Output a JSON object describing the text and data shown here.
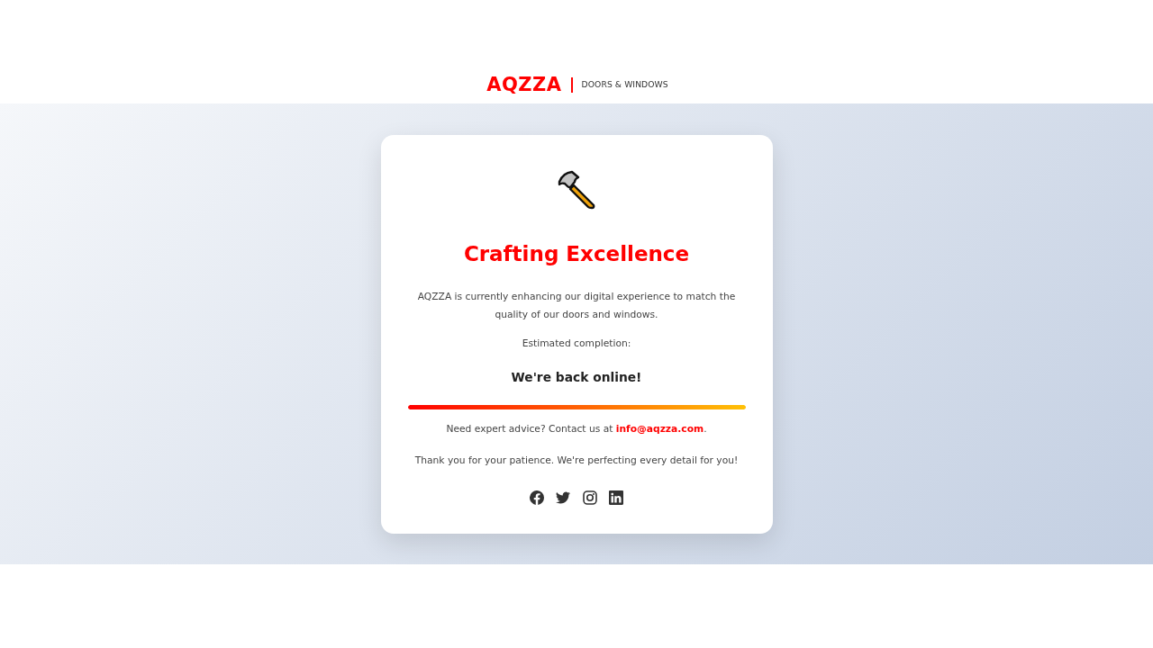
{
  "header": {
    "logo": "AQZZA",
    "tagline": "DOORS & WINDOWS"
  },
  "card": {
    "title": "Crafting Excellence",
    "message": "AQZZA is currently enhancing our digital experience to match the quality of our doors and windows.",
    "eta_label": "Estimated completion:",
    "eta_value": "We're back online!",
    "progress": {
      "level": 1
    },
    "contact": {
      "before": "Need expert advice? Contact us at ",
      "email": "info@aqzza.com",
      "after": "."
    },
    "thanks": "Thank you for your patience. We're perfecting every detail for you!",
    "social": [
      {
        "kind": "facebook"
      },
      {
        "kind": "twitter"
      },
      {
        "kind": "instagram"
      },
      {
        "kind": "linkedin"
      }
    ]
  }
}
